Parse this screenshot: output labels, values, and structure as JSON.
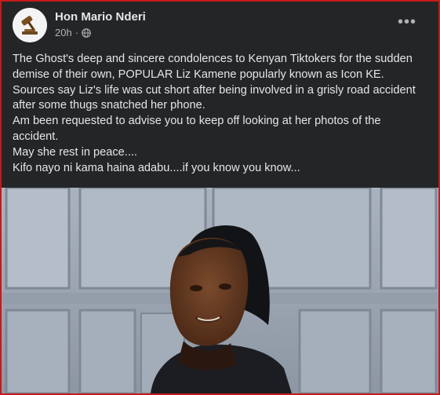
{
  "post": {
    "author": "Hon Mario Nderi",
    "time": "20h",
    "dot": "·",
    "more_label": "•••",
    "avatar_icon": "gavel-icon",
    "privacy_icon": "globe-icon",
    "paragraphs": [
      "The Ghost's deep and sincere condolences to Kenyan Tiktokers for the sudden demise of their own, POPULAR Liz Kamene popularly known as Icon KE. Sources say Liz's life was cut short after being involved in a grisly road accident after some thugs snatched her phone.",
      "Am been requested to advise you to keep off looking at her photos of the accident.",
      "May she rest in peace....",
      "Kifo nayo ni kama haina adabu....if you know you know..."
    ]
  },
  "colors": {
    "background": "#242526",
    "text": "#e4e6eb",
    "secondary_text": "#b0b3b8",
    "frame_border": "#c41a1a"
  }
}
